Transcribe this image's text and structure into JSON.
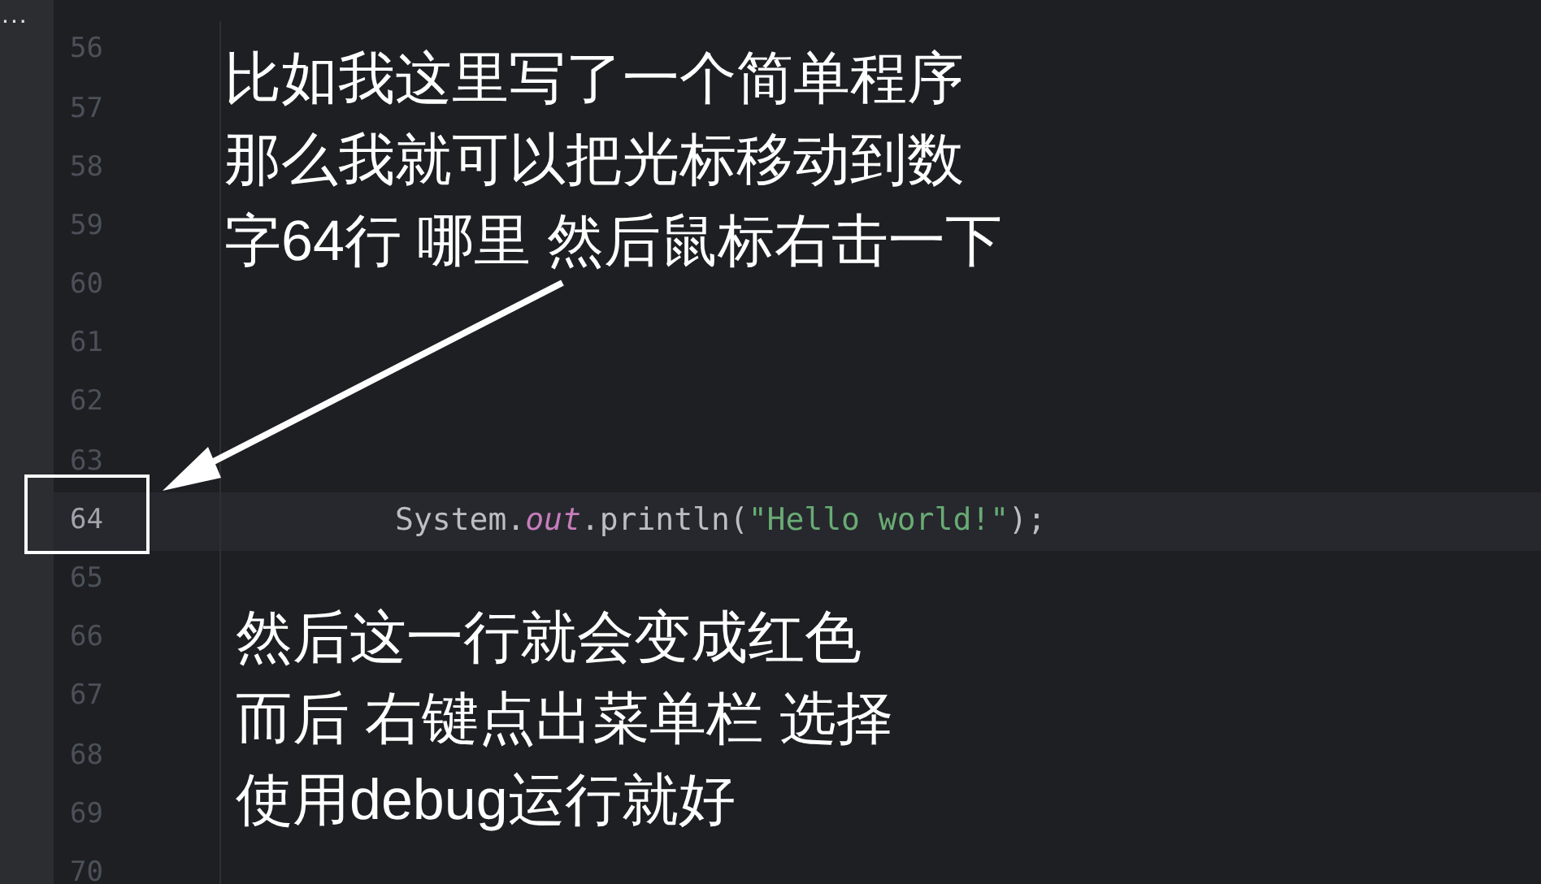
{
  "sidebar": {
    "more_label": "..."
  },
  "editor": {
    "lines": [
      {
        "number": "56",
        "current": false
      },
      {
        "number": "57",
        "current": false
      },
      {
        "number": "58",
        "current": false
      },
      {
        "number": "59",
        "current": false
      },
      {
        "number": "60",
        "current": false
      },
      {
        "number": "61",
        "current": false
      },
      {
        "number": "62",
        "current": false
      },
      {
        "number": "63",
        "current": false
      },
      {
        "number": "64",
        "current": true,
        "code": [
          {
            "kind": "plain",
            "text": "System."
          },
          {
            "kind": "field",
            "text": "out"
          },
          {
            "kind": "plain",
            "text": ".println("
          },
          {
            "kind": "string",
            "text": "\"Hello world!\""
          },
          {
            "kind": "plain",
            "text": ");"
          }
        ]
      },
      {
        "number": "65",
        "current": false
      },
      {
        "number": "66",
        "current": false
      },
      {
        "number": "67",
        "current": false
      },
      {
        "number": "68",
        "current": false
      },
      {
        "number": "69",
        "current": false
      },
      {
        "number": "70",
        "current": false
      }
    ]
  },
  "annotations": {
    "top_note": [
      "比如我这里写了一个简单程序",
      "那么我就可以把光标移动到数",
      "字64行 哪里 然后鼠标右击一下"
    ],
    "bottom_note": [
      "然后这一行就会变成红色",
      "而后 右键点出菜单栏 选择",
      "使用debug运行就好"
    ]
  }
}
